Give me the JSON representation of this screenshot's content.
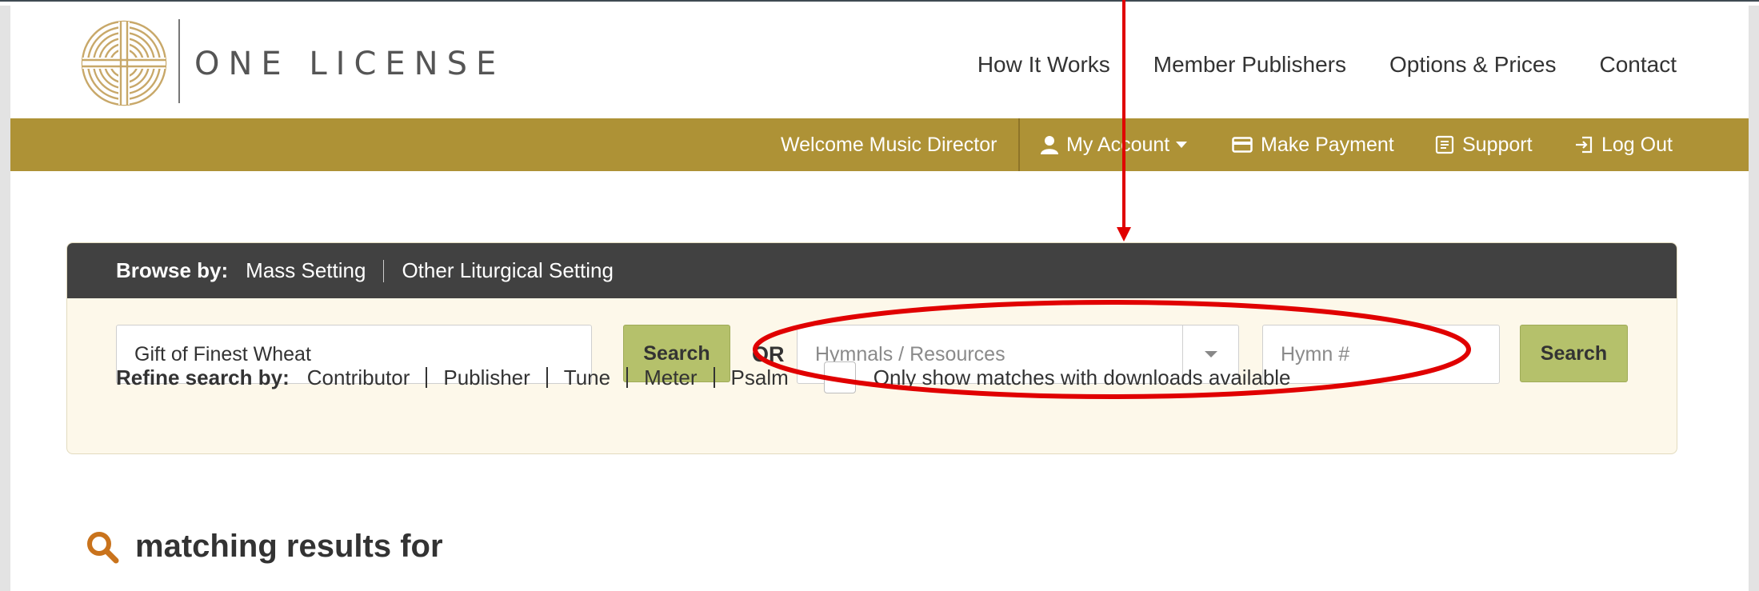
{
  "brand": {
    "name": "ONE LICENSE"
  },
  "main_nav": [
    {
      "label": "How It Works"
    },
    {
      "label": "Member Publishers"
    },
    {
      "label": "Options & Prices"
    },
    {
      "label": "Contact"
    }
  ],
  "account_bar": {
    "welcome": "Welcome Music Director",
    "my_account": "My Account",
    "make_payment": "Make Payment",
    "support": "Support",
    "log_out": "Log Out"
  },
  "browse": {
    "label": "Browse by:",
    "options": [
      "Mass Setting",
      "Other Liturgical Setting"
    ]
  },
  "search": {
    "query_value": "Gift of Finest Wheat",
    "search_label": "Search",
    "or_label": "OR",
    "hymnal_placeholder": "Hymnals / Resources",
    "hymn_number_placeholder": "Hymn #",
    "search2_label": "Search"
  },
  "refine": {
    "label": "Refine search by:",
    "options": [
      "Contributor",
      "Publisher",
      "Tune",
      "Meter",
      "Psalm"
    ],
    "downloads_checkbox_label": "Only show matches with downloads available",
    "downloads_checked": false
  },
  "results": {
    "heading": "matching results for"
  },
  "colors": {
    "gold_bar": "#ae9236",
    "browse_header": "#414141",
    "search_button": "#b5c16b",
    "panel_bg": "#fdf8ea",
    "annotation": "#e00000",
    "search_icon": "#c9731c"
  }
}
